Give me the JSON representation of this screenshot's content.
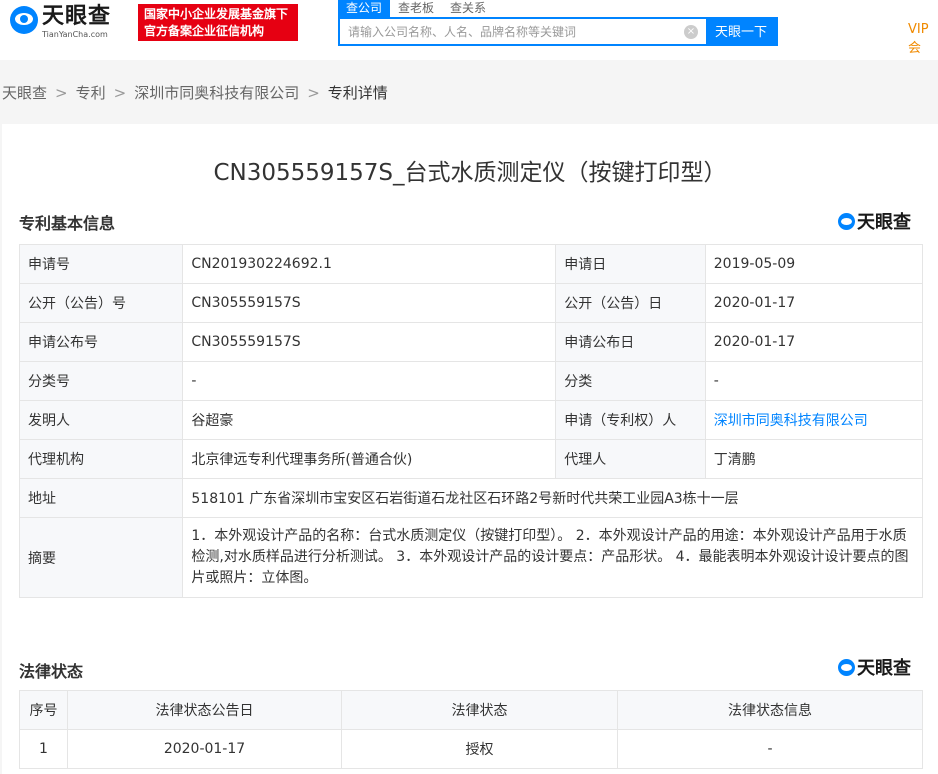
{
  "header": {
    "logo_cn": "天眼查",
    "logo_en": "TianYanCha.com",
    "badge_line1": "国家中小企业发展基金旗下",
    "badge_line2": "官方备案企业征信机构",
    "tabs": [
      {
        "label": "查公司",
        "active": true
      },
      {
        "label": "查老板",
        "active": false
      },
      {
        "label": "查关系",
        "active": false
      }
    ],
    "search_placeholder": "请输入公司名称、人名、品牌名称等关键词",
    "clear_icon": "×",
    "search_button": "天眼一下",
    "vip": "VIP会"
  },
  "breadcrumb": {
    "items": [
      "天眼查",
      "专利",
      "深圳市同奥科技有限公司"
    ],
    "current": "专利详情",
    "sep": ">"
  },
  "page_title": "CN305559157S_台式水质测定仪（按键打印型）",
  "basic": {
    "title": "专利基本信息",
    "logo": "天眼查",
    "rows": [
      {
        "l1": "申请号",
        "v1": "CN201930224692.1",
        "l2": "申请日",
        "v2": "2019-05-09"
      },
      {
        "l1": "公开（公告）号",
        "v1": "CN305559157S",
        "l2": "公开（公告）日",
        "v2": "2020-01-17"
      },
      {
        "l1": "申请公布号",
        "v1": "CN305559157S",
        "l2": "申请公布日",
        "v2": "2020-01-17"
      },
      {
        "l1": "分类号",
        "v1": "-",
        "l2": "分类",
        "v2": "-"
      },
      {
        "l1": "发明人",
        "v1": "谷超豪",
        "l2": "申请（专利权）人",
        "v2": "深圳市同奥科技有限公司"
      },
      {
        "l1": "代理机构",
        "v1": "北京律远专利代理事务所(普通合伙)",
        "l2": "代理人",
        "v2": "丁清鹏"
      }
    ],
    "address_label": "地址",
    "address": "518101 广东省深圳市宝安区石岩街道石龙社区石环路2号新时代共荣工业园A3栋十一层",
    "abstract_label": "摘要",
    "abstract": "1．本外观设计产品的名称：台式水质测定仪（按键打印型）。 2．本外观设计产品的用途：本外观设计产品用于水质检测,对水质样品进行分析测试。 3．本外观设计产品的设计要点：产品形状。 4．最能表明本外观设计设计要点的图片或照片：立体图。"
  },
  "legal": {
    "title": "法律状态",
    "logo": "天眼查",
    "headers": [
      "序号",
      "法律状态公告日",
      "法律状态",
      "法律状态信息"
    ],
    "rows": [
      {
        "no": "1",
        "date": "2020-01-17",
        "status": "授权",
        "info": "-"
      }
    ]
  }
}
